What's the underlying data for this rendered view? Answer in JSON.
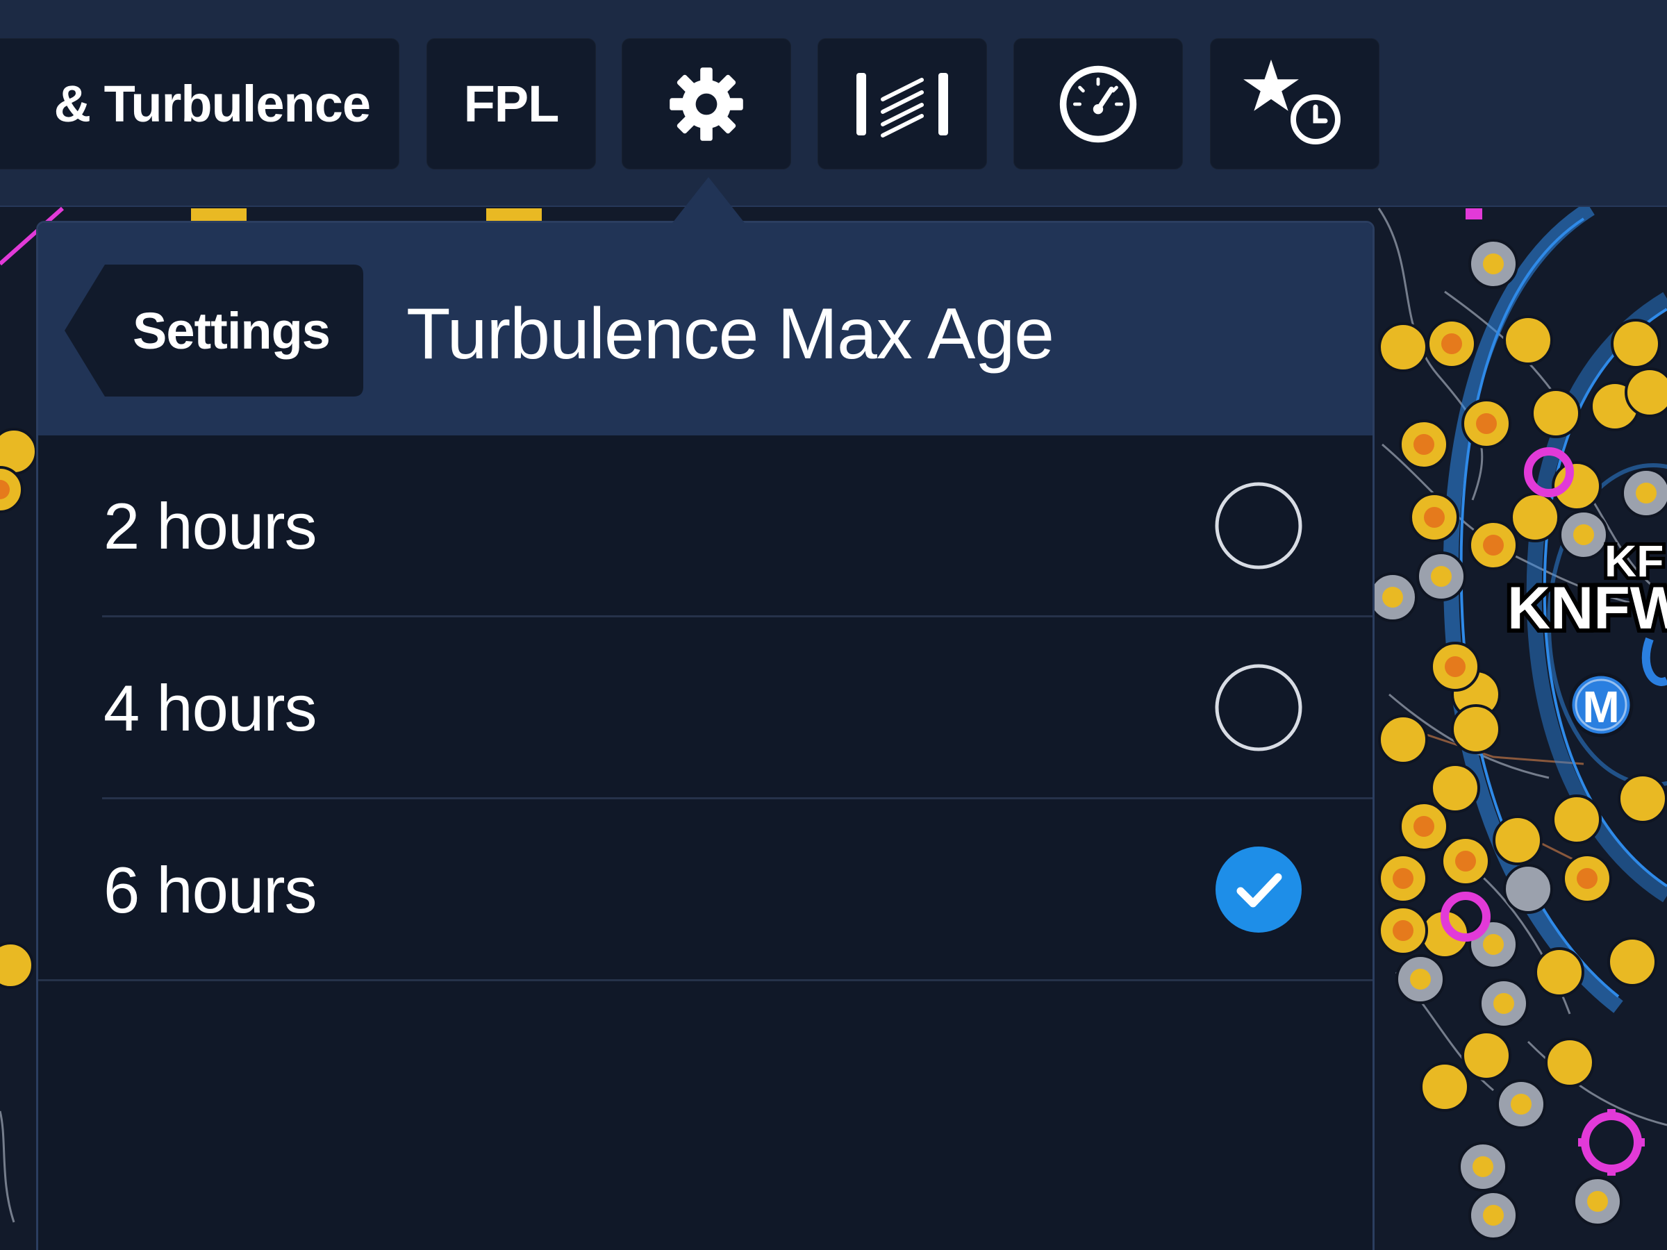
{
  "toolbar": {
    "layer_label": "& Turbulence",
    "fpl_label": "FPL",
    "settings_icon": "gear-icon",
    "profile_icon": "profile-view-icon",
    "instruments_icon": "gauge-icon",
    "recents_icon": "star-clock-icon"
  },
  "popover": {
    "back_label": "Settings",
    "title": "Turbulence Max Age",
    "options": [
      {
        "label": "2 hours",
        "selected": false
      },
      {
        "label": "4 hours",
        "selected": false
      },
      {
        "label": "6 hours",
        "selected": true
      }
    ]
  },
  "map": {
    "labels": [
      "KNFW",
      "KF"
    ],
    "marker_letter": "M"
  },
  "colors": {
    "toolbar_bg": "#1c2a44",
    "button_bg": "#111a2b",
    "popover_header": "#213456",
    "popover_body": "#101828",
    "accent_blue": "#1e8ee8",
    "airport_yellow": "#e9b923",
    "airport_orange": "#e57a1c",
    "airport_gray": "#9ba1ad",
    "magenta": "#e23ad8",
    "airspace_blue": "#2f8ae8"
  }
}
